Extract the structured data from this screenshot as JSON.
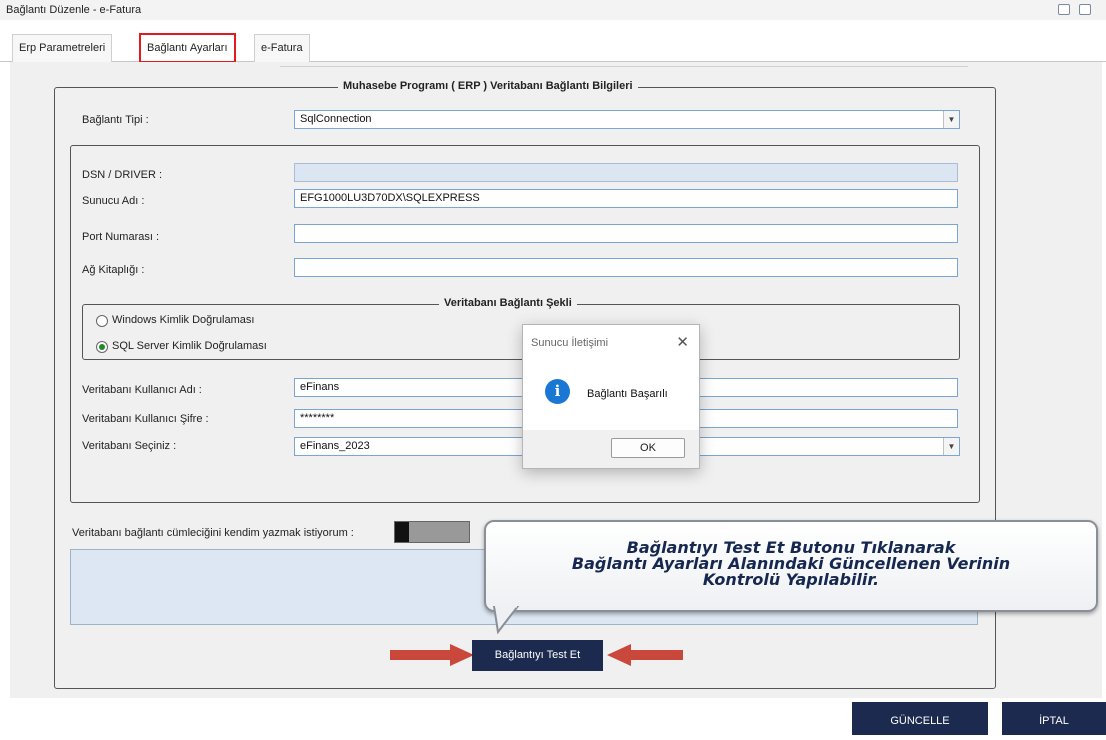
{
  "window": {
    "title": "Bağlantı Düzenle - e-Fatura"
  },
  "tabs": [
    {
      "label": "Erp Parametreleri",
      "active": false
    },
    {
      "label": "Bağlantı Ayarları",
      "active": true
    },
    {
      "label": "e-Fatura",
      "active": false
    }
  ],
  "erp_group": {
    "title": "Muhasebe Programı ( ERP ) Veritabanı Bağlantı Bilgileri",
    "connection_type_label": "Bağlantı Tipi :",
    "connection_type_value": "SqlConnection"
  },
  "server_fields": {
    "dsn_label": "DSN / DRIVER :",
    "dsn_value": "",
    "server_label": "Sunucu Adı :",
    "server_value": "EFG1000LU3D70DX\\SQLEXPRESS",
    "port_label": "Port Numarası :",
    "port_value": "",
    "library_label": "Ağ Kitaplığı :",
    "library_value": ""
  },
  "auth_group": {
    "title": "Veritabanı Bağlantı Şekli",
    "windows_auth_label": "Windows Kimlik Doğrulaması",
    "sql_auth_label": "SQL Server Kimlik Doğrulaması",
    "selected": "sql"
  },
  "db_fields": {
    "username_label": "Veritabanı Kullanıcı Adı :",
    "username_value": "eFinans",
    "password_label": "Veritabanı Kullanıcı Şifre :",
    "password_value": "********",
    "database_label": "Veritabanı Seçiniz :",
    "database_value": "eFinans_2023"
  },
  "custom_connection": {
    "label": "Veritabanı bağlantı cümleciğini kendim yazmak istiyorum :"
  },
  "buttons": {
    "test": "Bağlantıyı Test Et",
    "update": "GÜNCELLE",
    "cancel": "İPTAL"
  },
  "dialog": {
    "title": "Sunucu İletişimi",
    "message": "Bağlantı Başarılı",
    "ok": "OK",
    "icon": "info-icon"
  },
  "callout": {
    "line1": "Bağlantıyı Test Et Butonu Tıklanarak",
    "line2": "Bağlantı Ayarları Alanındaki Güncellenen Verinin",
    "line3": "Kontrolü Yapılabilir."
  },
  "colors": {
    "dark_button": "#1b2a4e",
    "tab_highlight": "#e01b1b",
    "arrow": "#c9473b",
    "info_icon": "#1a78d4",
    "callout_text": "#16284f"
  }
}
